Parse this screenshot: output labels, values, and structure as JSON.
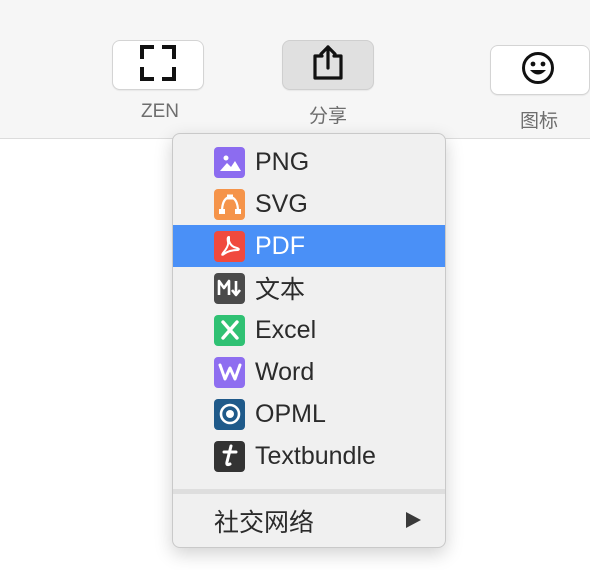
{
  "toolbar": {
    "zen": {
      "label": "ZEN",
      "icon": "fullscreen-corners-icon"
    },
    "share": {
      "label": "分享",
      "icon": "share-upload-icon"
    },
    "icon": {
      "label": "图标",
      "icon": "smiley-icon"
    }
  },
  "menu": {
    "items": [
      {
        "label": "PNG",
        "icon": "image-icon",
        "color": "#8c6cf0"
      },
      {
        "label": "SVG",
        "icon": "vector-path-icon",
        "color": "#f5944a"
      },
      {
        "label": "PDF",
        "icon": "pdf-icon",
        "color": "#f04a3e"
      },
      {
        "label": "文本",
        "icon": "markdown-icon",
        "color": "#4a4a4a"
      },
      {
        "label": "Excel",
        "icon": "excel-icon",
        "color": "#2fc173"
      },
      {
        "label": "Word",
        "icon": "word-icon",
        "color": "#8e6ef0"
      },
      {
        "label": "OPML",
        "icon": "opml-icon",
        "color": "#1f5a8a"
      },
      {
        "label": "Textbundle",
        "icon": "textbundle-icon",
        "color": "#333333"
      }
    ],
    "selected_index": 2,
    "social": {
      "label": "社交网络",
      "icon": "submenu-arrow-icon"
    }
  }
}
